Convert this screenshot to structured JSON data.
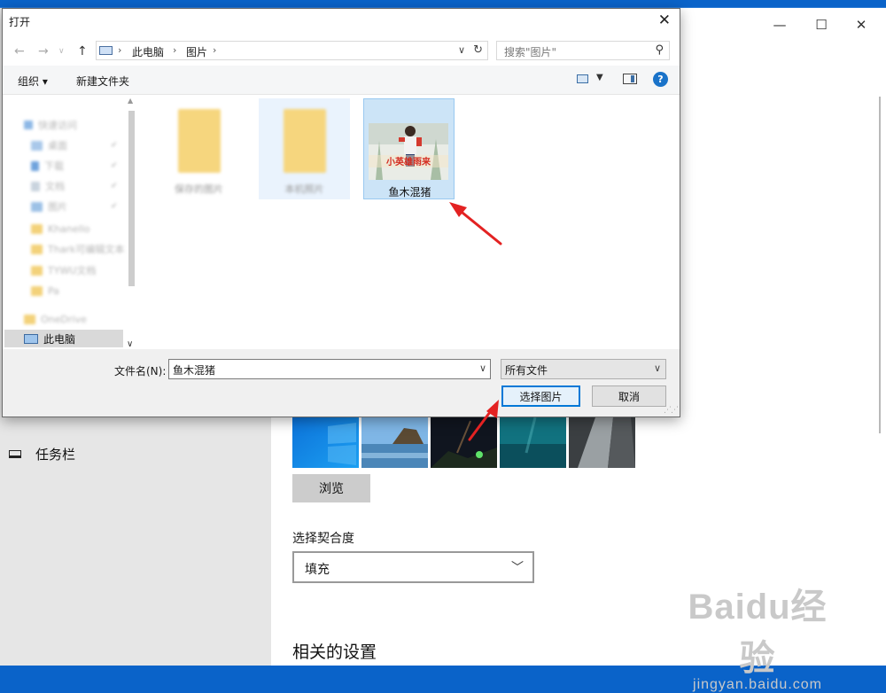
{
  "settings": {
    "sidebar": {
      "taskbar_label": "任务栏"
    },
    "browse_label": "浏览",
    "fit": {
      "label": "选择契合度",
      "value": "填充"
    },
    "related_heading": "相关的设置",
    "window_controls": {
      "minimize": "—",
      "maximize": "☐",
      "close": "✕"
    },
    "watermark": {
      "main": "Baidu经验",
      "sub": "jingyan.baidu.com"
    }
  },
  "dialog": {
    "title": "打开",
    "close_glyph": "✕",
    "nav": {
      "back": "←",
      "forward": "→",
      "up": "↑"
    },
    "breadcrumb": [
      "此电脑",
      "图片"
    ],
    "breadcrumb_sep": "›",
    "search_placeholder": "搜索\"图片\"",
    "toolbar": {
      "organize": "组织 ▾",
      "new_folder": "新建文件夹",
      "help": "?"
    },
    "navpane": {
      "quick_access": "快速访问",
      "items": [
        {
          "label": "桌面",
          "icon": "desktop-icon"
        },
        {
          "label": "下载",
          "icon": "download-icon"
        },
        {
          "label": "文档",
          "icon": "document-icon"
        },
        {
          "label": "图片",
          "icon": "pictures-icon"
        },
        {
          "label": "Khanello",
          "icon": "folder-icon"
        },
        {
          "label": "Thark可编辑文本",
          "icon": "folder-icon"
        },
        {
          "label": "TYWU文档",
          "icon": "folder-icon"
        },
        {
          "label": "Pa",
          "icon": "folder-icon"
        }
      ],
      "onedrive": "OneDrive",
      "this_pc": "此电脑"
    },
    "files": [
      {
        "name": "保存的图片",
        "type": "folder"
      },
      {
        "name": "本机照片",
        "type": "folder"
      },
      {
        "name": "鱼木混猪",
        "type": "image",
        "selected": true
      }
    ],
    "image_caption_text": "小英雄雨来",
    "filename_label": "文件名(N):",
    "filename_value": "鱼木混猪",
    "filetype_value": "所有文件",
    "open_button": "选择图片",
    "cancel_button": "取消"
  },
  "colors": {
    "accent": "#0078d7",
    "selection": "#cce4f7",
    "annotation_arrow": "#e32222",
    "folder": "#f6d67e"
  }
}
